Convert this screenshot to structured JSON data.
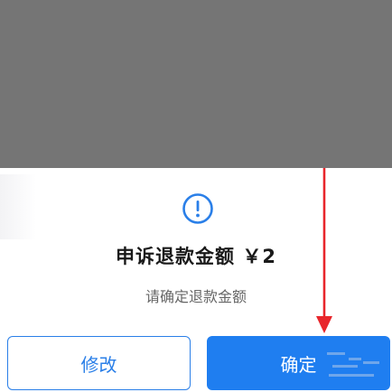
{
  "dialog": {
    "title": "申诉退款金额 ￥2",
    "subtitle": "请确定退款金额",
    "icon": "info-circle-icon",
    "accent_color": "#1f7ef0",
    "overlay_color": "#757575"
  },
  "buttons": {
    "modify_label": "修改",
    "confirm_label": "确定"
  },
  "annotation": {
    "arrow_color": "#e8262b"
  }
}
